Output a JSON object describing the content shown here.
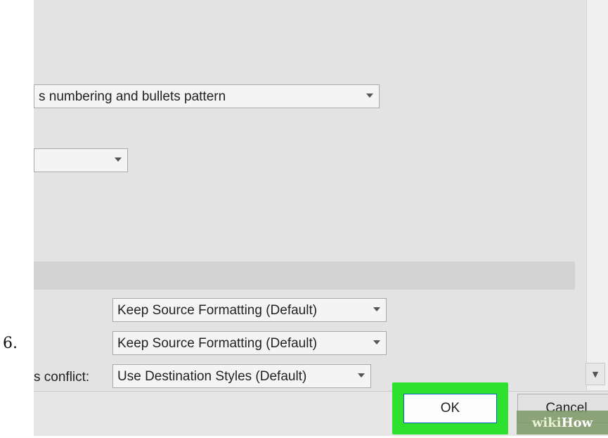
{
  "step_number": "6.",
  "options": {
    "numbering_dropdown": {
      "value": "s numbering and bullets pattern"
    },
    "small_dropdown": {
      "value": ""
    }
  },
  "paste": {
    "row1": {
      "label": "",
      "value": "Keep Source Formatting (Default)"
    },
    "row2": {
      "label": "",
      "value": "Keep Source Formatting (Default)"
    },
    "row3": {
      "label": "s conflict:",
      "value": "Use Destination Styles (Default)"
    }
  },
  "buttons": {
    "ok": "OK",
    "cancel": "Cancel"
  },
  "watermark": {
    "part1": "wiki",
    "part2": "How"
  },
  "colors": {
    "highlight": "#2fe12f",
    "dialog_bg": "#e3e3e3",
    "ok_border": "#0a64c8"
  }
}
